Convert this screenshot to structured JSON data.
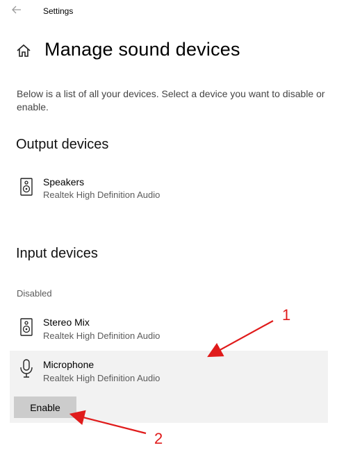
{
  "titlebar": {
    "back_icon": "back-arrow-icon",
    "title": "Settings"
  },
  "page": {
    "home_icon": "home-icon",
    "title": "Manage sound devices",
    "description": "Below is a list of all your devices. Select a device you want to disable or enable."
  },
  "output_devices": {
    "heading": "Output devices",
    "items": [
      {
        "name": "Speakers",
        "driver": "Realtek High Definition Audio",
        "icon": "speaker-icon"
      }
    ]
  },
  "input_devices": {
    "heading": "Input devices",
    "group_label": "Disabled",
    "items": [
      {
        "name": "Stereo Mix",
        "driver": "Realtek High Definition Audio",
        "icon": "speaker-icon"
      },
      {
        "name": "Microphone",
        "driver": "Realtek High Definition Audio",
        "icon": "microphone-icon",
        "selected": true
      }
    ],
    "enable_button": "Enable"
  },
  "annotations": [
    {
      "label": "1",
      "color": "#e01b1b"
    },
    {
      "label": "2",
      "color": "#e01b1b"
    }
  ],
  "colors": {
    "selected_bg": "#f2f2f2",
    "button_bg": "#cccccc",
    "annotation": "#e01b1b"
  }
}
